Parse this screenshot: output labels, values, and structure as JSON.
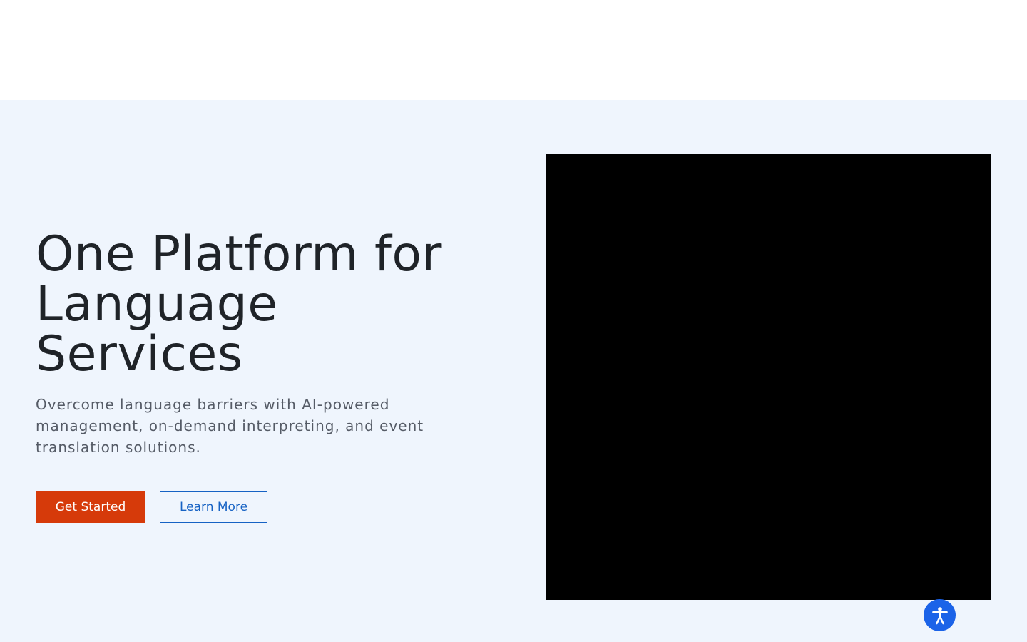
{
  "hero": {
    "title": "One Platform for Language Services",
    "subtitle": "Overcome language barriers with AI-powered management, on-demand interpreting, and event translation solutions.",
    "primary_cta": "Get Started",
    "secondary_cta": "Learn More"
  },
  "accessibility": {
    "icon": "accessibility-person-icon",
    "color": "#1b63e8"
  },
  "colors": {
    "hero_background": "#eff5fd",
    "primary_button": "#d63a0a",
    "secondary_button_border": "#1662c4",
    "media_background": "#000000"
  }
}
